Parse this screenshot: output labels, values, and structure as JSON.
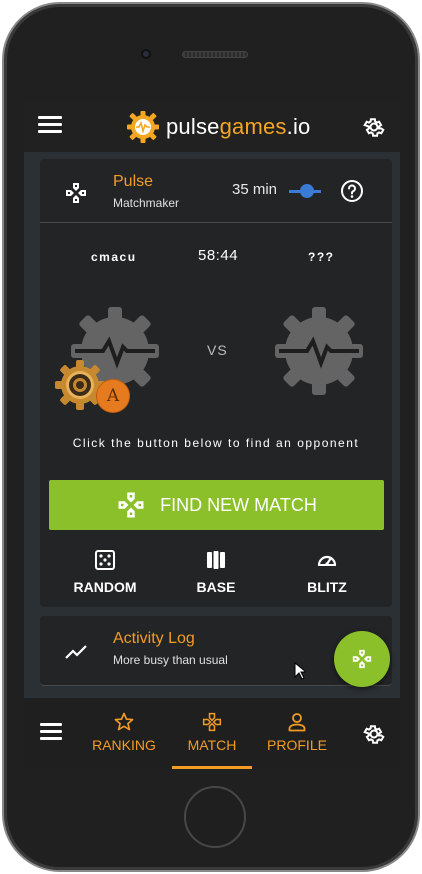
{
  "header": {
    "brand_part1": "pulse",
    "brand_part2": "games",
    "brand_part3": ".io",
    "menu_icon": "hamburger-menu-icon",
    "settings_icon": "gear-icon"
  },
  "match_card": {
    "title": "Pulse",
    "subtitle": "Matchmaker",
    "duration": "35 min",
    "player_left": "cmacu",
    "timer": "58:44",
    "player_right": "???",
    "vs": "VS",
    "hint": "Click the button below to find an opponent",
    "avatar_badge": "A",
    "find_button": "FIND NEW MATCH",
    "modes": [
      {
        "label": "RANDOM",
        "icon": "dice-icon"
      },
      {
        "label": "BASE",
        "icon": "pillars-icon"
      },
      {
        "label": "BLITZ",
        "icon": "speedometer-icon"
      }
    ]
  },
  "activity": {
    "title": "Activity Log",
    "subtitle": "More busy than usual"
  },
  "bottom_nav": {
    "tabs": [
      {
        "label": "RANKING",
        "icon": "star-icon"
      },
      {
        "label": "MATCH",
        "icon": "gamepad-icon"
      },
      {
        "label": "PROFILE",
        "icon": "person-icon"
      }
    ],
    "active_tab": "MATCH"
  },
  "colors": {
    "accent_orange": "#f39c24",
    "action_green": "#8bc02a",
    "slider_blue": "#3a7bd5"
  }
}
